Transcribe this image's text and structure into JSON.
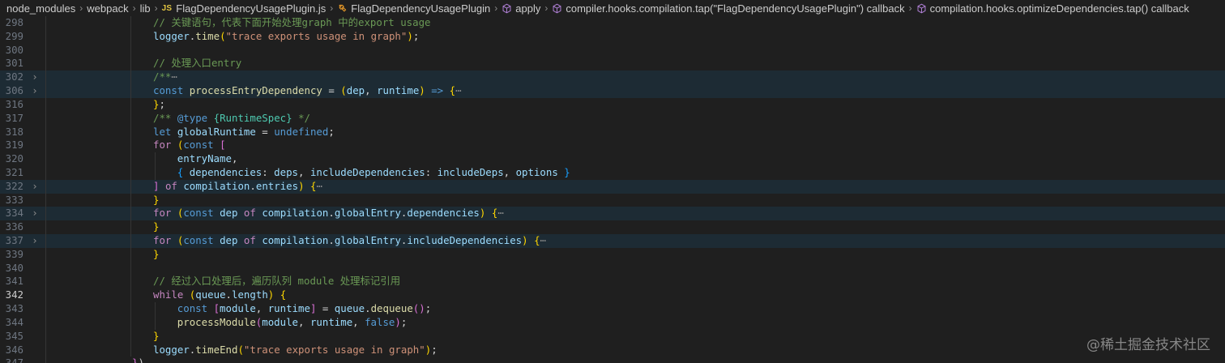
{
  "breadcrumb": {
    "items": [
      {
        "label": "node_modules"
      },
      {
        "label": "webpack"
      },
      {
        "label": "lib"
      },
      {
        "label": "FlagDependencyUsagePlugin.js",
        "badge": "JS"
      },
      {
        "label": "FlagDependencyUsagePlugin",
        "icon": "class-icon"
      },
      {
        "label": "apply",
        "icon": "method-icon"
      },
      {
        "label": "compiler.hooks.compilation.tap(\"FlagDependencyUsagePlugin\") callback",
        "icon": "method-icon"
      },
      {
        "label": "compilation.hooks.optimizeDependencies.tap() callback",
        "icon": "method-icon"
      }
    ]
  },
  "editor": {
    "colors": {
      "background": "#1f1f1f",
      "highlight": "#1d2b34"
    },
    "lines": [
      {
        "num": "298",
        "indent": 1,
        "tokens": [
          [
            "cm",
            "// 关键语句，代表下面开始处理graph 中的export usage"
          ]
        ]
      },
      {
        "num": "299",
        "indent": 1,
        "tokens": [
          [
            "var",
            "logger"
          ],
          [
            "op",
            "."
          ],
          [
            "fn",
            "time"
          ],
          [
            "p1",
            "("
          ],
          [
            "str",
            "\"trace exports usage in graph\""
          ],
          [
            "p1",
            ")"
          ],
          [
            "op",
            ";"
          ]
        ]
      },
      {
        "num": "300",
        "indent": 1,
        "tokens": []
      },
      {
        "num": "301",
        "indent": 1,
        "tokens": [
          [
            "cm",
            "// 处理入口entry"
          ]
        ]
      },
      {
        "num": "302",
        "indent": 1,
        "fold": true,
        "hl": true,
        "tokens": [
          [
            "cm",
            "/**"
          ],
          [
            "ell",
            "⋯"
          ]
        ]
      },
      {
        "num": "306",
        "indent": 1,
        "fold": true,
        "hl": true,
        "tokens": [
          [
            "kw",
            "const "
          ],
          [
            "fn",
            "processEntryDependency"
          ],
          [
            "op",
            " = "
          ],
          [
            "p1",
            "("
          ],
          [
            "var",
            "dep"
          ],
          [
            "op",
            ", "
          ],
          [
            "var",
            "runtime"
          ],
          [
            "p1",
            ")"
          ],
          [
            "op",
            " "
          ],
          [
            "kw",
            "=>"
          ],
          [
            "op",
            " "
          ],
          [
            "p1",
            "{"
          ],
          [
            "ell",
            "⋯"
          ]
        ]
      },
      {
        "num": "316",
        "indent": 1,
        "tokens": [
          [
            "p1",
            "}"
          ],
          [
            "op",
            ";"
          ]
        ]
      },
      {
        "num": "317",
        "indent": 1,
        "tokens": [
          [
            "cm",
            "/** "
          ],
          [
            "kw",
            "@type"
          ],
          [
            "cm",
            " "
          ],
          [
            "ty",
            "{RuntimeSpec}"
          ],
          [
            "cm",
            " */"
          ]
        ]
      },
      {
        "num": "318",
        "indent": 1,
        "tokens": [
          [
            "kw",
            "let "
          ],
          [
            "var",
            "globalRuntime"
          ],
          [
            "op",
            " = "
          ],
          [
            "kw",
            "undefined"
          ],
          [
            "op",
            ";"
          ]
        ]
      },
      {
        "num": "319",
        "indent": 1,
        "tokens": [
          [
            "ct",
            "for "
          ],
          [
            "p1",
            "("
          ],
          [
            "kw",
            "const "
          ],
          [
            "p2",
            "["
          ]
        ]
      },
      {
        "num": "320",
        "indent": 2,
        "tokens": [
          [
            "var",
            "entryName"
          ],
          [
            "op",
            ","
          ]
        ]
      },
      {
        "num": "321",
        "indent": 2,
        "tokens": [
          [
            "p3",
            "{ "
          ],
          [
            "var",
            "dependencies"
          ],
          [
            "op",
            ": "
          ],
          [
            "var",
            "deps"
          ],
          [
            "op",
            ", "
          ],
          [
            "var",
            "includeDependencies"
          ],
          [
            "op",
            ": "
          ],
          [
            "var",
            "includeDeps"
          ],
          [
            "op",
            ", "
          ],
          [
            "var",
            "options"
          ],
          [
            "p3",
            " }"
          ]
        ]
      },
      {
        "num": "322",
        "indent": 1,
        "fold": true,
        "hl": true,
        "tokens": [
          [
            "p2",
            "]"
          ],
          [
            "op",
            " "
          ],
          [
            "ct",
            "of "
          ],
          [
            "var",
            "compilation"
          ],
          [
            "op",
            "."
          ],
          [
            "var",
            "entries"
          ],
          [
            "p1",
            ")"
          ],
          [
            "op",
            " "
          ],
          [
            "p1",
            "{"
          ],
          [
            "ell",
            "⋯"
          ]
        ]
      },
      {
        "num": "333",
        "indent": 1,
        "tokens": [
          [
            "p1",
            "}"
          ]
        ]
      },
      {
        "num": "334",
        "indent": 1,
        "fold": true,
        "hl": true,
        "tokens": [
          [
            "ct",
            "for "
          ],
          [
            "p1",
            "("
          ],
          [
            "kw",
            "const "
          ],
          [
            "var",
            "dep"
          ],
          [
            "ct",
            " of "
          ],
          [
            "var",
            "compilation"
          ],
          [
            "op",
            "."
          ],
          [
            "var",
            "globalEntry"
          ],
          [
            "op",
            "."
          ],
          [
            "var",
            "dependencies"
          ],
          [
            "p1",
            ")"
          ],
          [
            "op",
            " "
          ],
          [
            "p1",
            "{"
          ],
          [
            "ell",
            "⋯"
          ]
        ]
      },
      {
        "num": "336",
        "indent": 1,
        "tokens": [
          [
            "p1",
            "}"
          ]
        ]
      },
      {
        "num": "337",
        "indent": 1,
        "fold": true,
        "hl": true,
        "tokens": [
          [
            "ct",
            "for "
          ],
          [
            "p1",
            "("
          ],
          [
            "kw",
            "const "
          ],
          [
            "var",
            "dep"
          ],
          [
            "ct",
            " of "
          ],
          [
            "var",
            "compilation"
          ],
          [
            "op",
            "."
          ],
          [
            "var",
            "globalEntry"
          ],
          [
            "op",
            "."
          ],
          [
            "var",
            "includeDependencies"
          ],
          [
            "p1",
            ")"
          ],
          [
            "op",
            " "
          ],
          [
            "p1",
            "{"
          ],
          [
            "ell",
            "⋯"
          ]
        ]
      },
      {
        "num": "339",
        "indent": 1,
        "tokens": [
          [
            "p1",
            "}"
          ]
        ]
      },
      {
        "num": "340",
        "indent": 1,
        "tokens": []
      },
      {
        "num": "341",
        "indent": 1,
        "tokens": [
          [
            "cm",
            "// 经过入口处理后，遍历队列 module 处理标记引用"
          ]
        ]
      },
      {
        "num": "342",
        "indent": 1,
        "current": true,
        "tokens": [
          [
            "ct",
            "while "
          ],
          [
            "p1",
            "("
          ],
          [
            "var",
            "queue"
          ],
          [
            "op",
            "."
          ],
          [
            "var",
            "length"
          ],
          [
            "p1",
            ")"
          ],
          [
            "op",
            " "
          ],
          [
            "p1",
            "{"
          ]
        ]
      },
      {
        "num": "343",
        "indent": 2,
        "tokens": [
          [
            "kw",
            "const "
          ],
          [
            "p2",
            "["
          ],
          [
            "var",
            "module"
          ],
          [
            "op",
            ", "
          ],
          [
            "var",
            "runtime"
          ],
          [
            "p2",
            "]"
          ],
          [
            "op",
            " = "
          ],
          [
            "var",
            "queue"
          ],
          [
            "op",
            "."
          ],
          [
            "fn",
            "dequeue"
          ],
          [
            "p2",
            "()"
          ],
          [
            "op",
            ";"
          ]
        ]
      },
      {
        "num": "344",
        "indent": 2,
        "tokens": [
          [
            "fn",
            "processModule"
          ],
          [
            "p2",
            "("
          ],
          [
            "var",
            "module"
          ],
          [
            "op",
            ", "
          ],
          [
            "var",
            "runtime"
          ],
          [
            "op",
            ", "
          ],
          [
            "kw",
            "false"
          ],
          [
            "p2",
            ")"
          ],
          [
            "op",
            ";"
          ]
        ]
      },
      {
        "num": "345",
        "indent": 1,
        "tokens": [
          [
            "p1",
            "}"
          ]
        ]
      },
      {
        "num": "346",
        "indent": 1,
        "tokens": [
          [
            "var",
            "logger"
          ],
          [
            "op",
            "."
          ],
          [
            "fn",
            "timeEnd"
          ],
          [
            "p1",
            "("
          ],
          [
            "str",
            "\"trace exports usage in graph\""
          ],
          [
            "p1",
            ")"
          ],
          [
            "op",
            ";"
          ]
        ]
      },
      {
        "num": "347",
        "indent": 0,
        "tokens": [
          [
            "p2",
            "}"
          ],
          [
            "op",
            ")"
          ]
        ]
      }
    ]
  },
  "watermark": "@稀土掘金技术社区"
}
